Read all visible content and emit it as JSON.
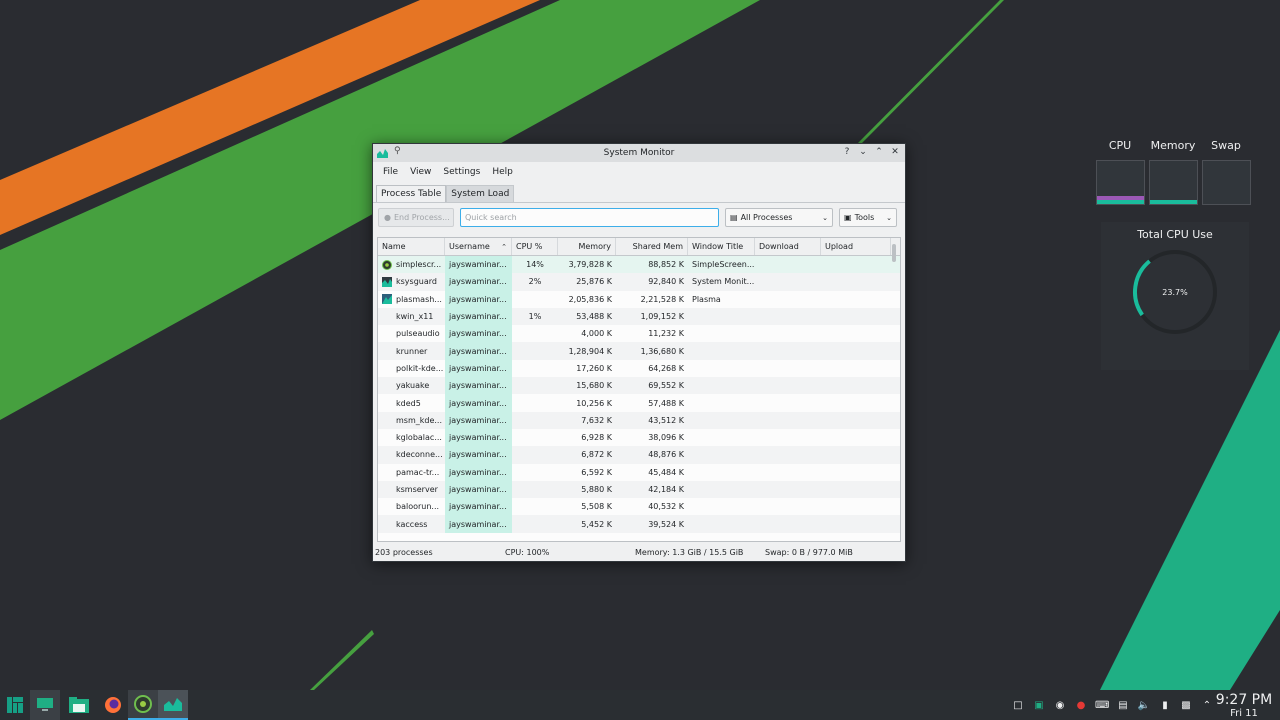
{
  "colors": {
    "accent": "#3daee9",
    "manjaro_green": "#16a085",
    "wall_orange": "#e67524",
    "wall_green": "#46a03f",
    "wall_teal": "#1faf84"
  },
  "widgets": {
    "system": {
      "labels": [
        "CPU",
        "Memory",
        "Swap"
      ]
    },
    "total_cpu": {
      "title": "Total CPU Use",
      "value": "23.7%",
      "fraction": 0.237
    }
  },
  "window": {
    "title": "System Monitor",
    "menu": [
      "File",
      "View",
      "Settings",
      "Help"
    ],
    "tabs": [
      "Process Table",
      "System Load"
    ],
    "toolbar": {
      "end_process": "End Process...",
      "search_placeholder": "Quick search",
      "filter": "All Processes",
      "tools": "Tools"
    },
    "columns": [
      "Name",
      "Username",
      "CPU %",
      "Memory",
      "Shared Mem",
      "Window Title",
      "Download",
      "Upload"
    ],
    "rows": [
      {
        "name": "simplescr...",
        "user": "jayswaminar...",
        "cpu": "14%",
        "mem": "3,79,828 K",
        "shared": "88,852 K",
        "title": "SimpleScreen...",
        "icon": "simplescreenrecorder-icon"
      },
      {
        "name": "ksysguard",
        "user": "jayswaminar...",
        "cpu": "2%",
        "mem": "25,876 K",
        "shared": "92,840 K",
        "title": "System Monit...",
        "icon": "ksysguard-icon"
      },
      {
        "name": "plasmash...",
        "user": "jayswaminar...",
        "cpu": "",
        "mem": "2,05,836 K",
        "shared": "2,21,528 K",
        "title": "Plasma",
        "icon": "plasma-icon"
      },
      {
        "name": "kwin_x11",
        "user": "jayswaminar...",
        "cpu": "1%",
        "mem": "53,488 K",
        "shared": "1,09,152 K",
        "title": ""
      },
      {
        "name": "pulseaudio",
        "user": "jayswaminar...",
        "cpu": "",
        "mem": "4,000 K",
        "shared": "11,232 K",
        "title": ""
      },
      {
        "name": "krunner",
        "user": "jayswaminar...",
        "cpu": "",
        "mem": "1,28,904 K",
        "shared": "1,36,680 K",
        "title": ""
      },
      {
        "name": "polkit-kde...",
        "user": "jayswaminar...",
        "cpu": "",
        "mem": "17,260 K",
        "shared": "64,268 K",
        "title": ""
      },
      {
        "name": "yakuake",
        "user": "jayswaminar...",
        "cpu": "",
        "mem": "15,680 K",
        "shared": "69,552 K",
        "title": ""
      },
      {
        "name": "kded5",
        "user": "jayswaminar...",
        "cpu": "",
        "mem": "10,256 K",
        "shared": "57,488 K",
        "title": ""
      },
      {
        "name": "msm_kde...",
        "user": "jayswaminar...",
        "cpu": "",
        "mem": "7,632 K",
        "shared": "43,512 K",
        "title": ""
      },
      {
        "name": "kglobalac...",
        "user": "jayswaminar...",
        "cpu": "",
        "mem": "6,928 K",
        "shared": "38,096 K",
        "title": ""
      },
      {
        "name": "kdeconne...",
        "user": "jayswaminar...",
        "cpu": "",
        "mem": "6,872 K",
        "shared": "48,876 K",
        "title": ""
      },
      {
        "name": "pamac-tr...",
        "user": "jayswaminar...",
        "cpu": "",
        "mem": "6,592 K",
        "shared": "45,484 K",
        "title": ""
      },
      {
        "name": "ksmserver",
        "user": "jayswaminar...",
        "cpu": "",
        "mem": "5,880 K",
        "shared": "42,184 K",
        "title": ""
      },
      {
        "name": "baloorun...",
        "user": "jayswaminar...",
        "cpu": "",
        "mem": "5,508 K",
        "shared": "40,532 K",
        "title": ""
      },
      {
        "name": "kaccess",
        "user": "jayswaminar...",
        "cpu": "",
        "mem": "5,452 K",
        "shared": "39,524 K",
        "title": ""
      }
    ],
    "status": {
      "processes": "203 processes",
      "cpu": "CPU: 100%",
      "memory": "Memory: 1.3 GiB / 15.5 GiB",
      "swap": "Swap: 0 B / 977.0 MiB"
    }
  },
  "taskbar": {
    "clock_time": "9:27 PM",
    "clock_date": "Fri 11"
  }
}
